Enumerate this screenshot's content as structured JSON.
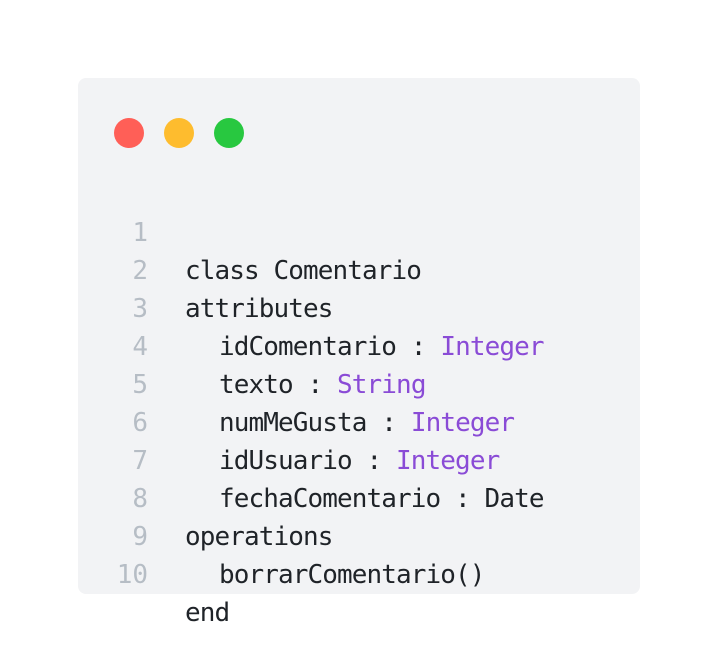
{
  "window": {
    "controls": {
      "close": {
        "color": "#ff5f57",
        "icon": "close-dot-icon"
      },
      "minimize": {
        "color": "#febc2e",
        "icon": "minimize-dot-icon"
      },
      "maximize": {
        "color": "#28c840",
        "icon": "maximize-dot-icon"
      }
    }
  },
  "theme": {
    "background": "#f2f3f5",
    "text": "#1f2328",
    "line_number": "#b6bdc5",
    "type_highlight": "#8a4bd6"
  },
  "code": {
    "lines": [
      {
        "num": "1",
        "text": "class Comentario"
      },
      {
        "num": "2",
        "text": "attributes"
      },
      {
        "num": "3",
        "name": "idComentario",
        "sep": " : ",
        "type": "Integer"
      },
      {
        "num": "4",
        "name": "texto",
        "sep": " : ",
        "type": "String"
      },
      {
        "num": "5",
        "name": "numMeGusta",
        "sep": " : ",
        "type": "Integer"
      },
      {
        "num": "6",
        "name": "idUsuario",
        "sep": " : ",
        "type": "Integer"
      },
      {
        "num": "7",
        "text": "fechaComentario : Date"
      },
      {
        "num": "8",
        "text": "operations"
      },
      {
        "num": "9",
        "text": "borrarComentario()"
      },
      {
        "num": "10",
        "text": "end"
      }
    ]
  }
}
